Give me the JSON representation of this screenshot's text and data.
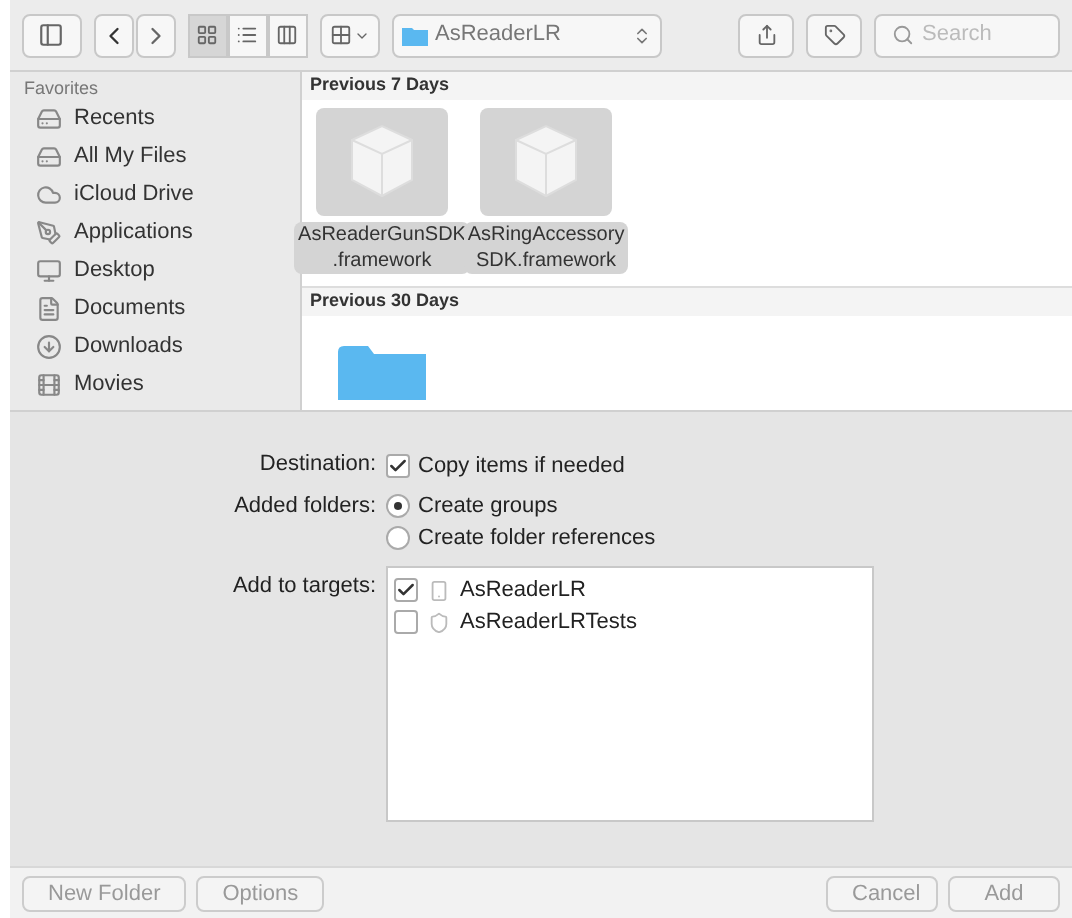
{
  "toolbar": {
    "view_modes": [
      {
        "kind": "icons",
        "selected": true
      },
      {
        "kind": "list",
        "selected": false
      },
      {
        "kind": "columns",
        "selected": false
      }
    ],
    "location": "AsReaderLR",
    "search": {
      "placeholder": "Search"
    }
  },
  "sidebar": {
    "heading": "Favorites",
    "items": [
      {
        "label": "Recents",
        "kind": "drive"
      },
      {
        "label": "All My Files",
        "kind": "drive"
      },
      {
        "label": "iCloud Drive",
        "kind": "cloud"
      },
      {
        "label": "Applications",
        "kind": "apps"
      },
      {
        "label": "Desktop",
        "kind": "desktop"
      },
      {
        "label": "Documents",
        "kind": "document"
      },
      {
        "label": "Downloads",
        "kind": "download"
      },
      {
        "label": "Movies",
        "kind": "movie"
      }
    ]
  },
  "sections": [
    {
      "title": "Previous 7 Days",
      "files": [
        {
          "kind": "framework",
          "name": [
            "AsReaderGunSDK",
            ".framework"
          ],
          "selected": true
        },
        {
          "kind": "framework",
          "name": [
            "AsRingAccessory",
            "SDK.framework"
          ],
          "selected": true
        }
      ]
    },
    {
      "title": "Previous 30 Days",
      "files": [
        {
          "kind": "folder",
          "selected": false
        }
      ]
    }
  ],
  "options": {
    "destination_label": "Destination:",
    "copy": {
      "label": "Copy items if needed",
      "checked": true
    },
    "folders_label": "Added folders:",
    "folder_choices": [
      {
        "label": "Create groups",
        "selected": true
      },
      {
        "label": "Create folder references",
        "selected": false
      }
    ],
    "targets_label": "Add to targets:",
    "targets": [
      {
        "label": "AsReaderLR",
        "kind": "app",
        "checked": true
      },
      {
        "label": "AsReaderLRTests",
        "kind": "tests",
        "checked": false
      }
    ]
  },
  "buttons": {
    "left": [
      "New Folder",
      "Options"
    ],
    "right": [
      "Cancel",
      "Add"
    ]
  }
}
